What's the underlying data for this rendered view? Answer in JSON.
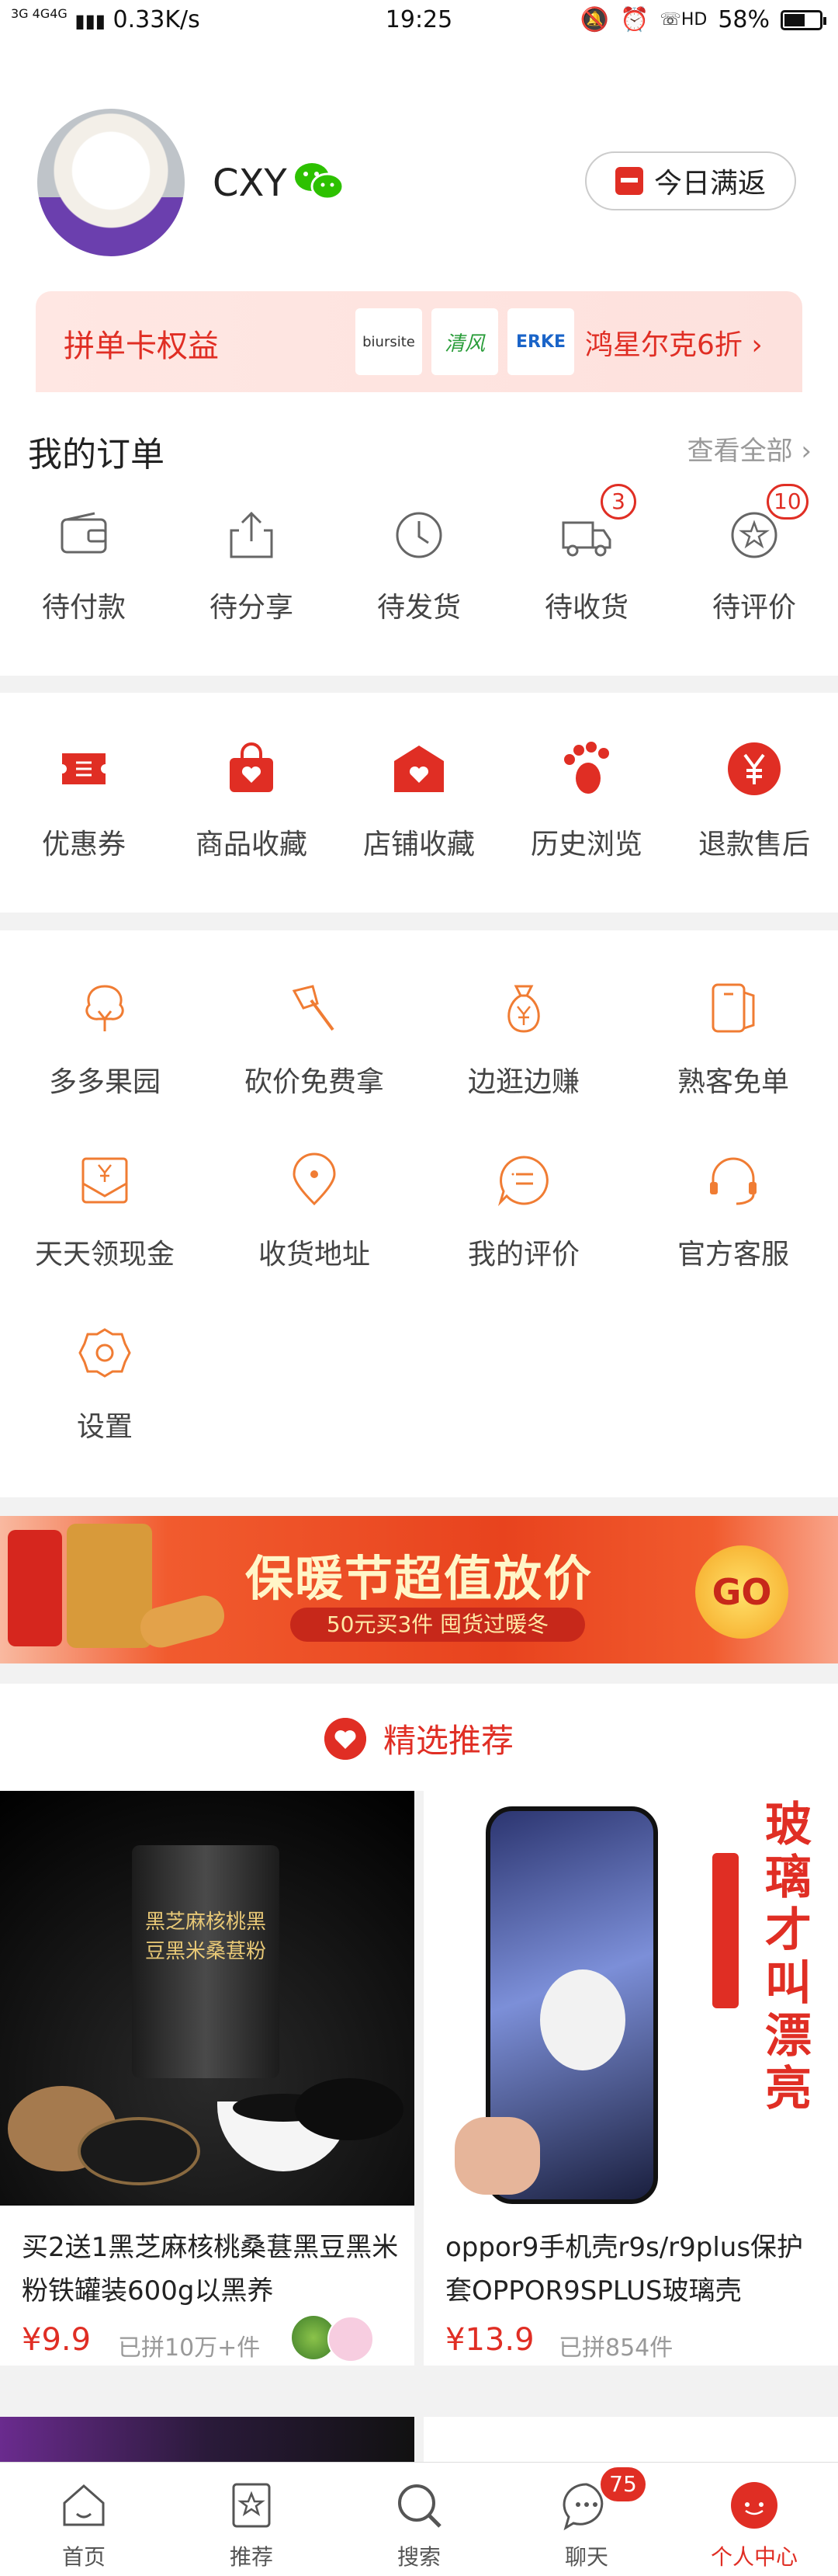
{
  "status_bar": {
    "network": "3G 4G4G",
    "speed": "0.33K/s",
    "time": "19:25",
    "battery": "58%",
    "battery_level": 0.58
  },
  "profile": {
    "username": "CXY",
    "today_button": "今日满返"
  },
  "benefit": {
    "title": "拼单卡权益",
    "brands": [
      "biursite",
      "清风",
      "ERKE"
    ],
    "promo": "鸿星尔克6折"
  },
  "orders": {
    "title": "我的订单",
    "view_all": "查看全部",
    "items": [
      {
        "label": "待付款",
        "icon": "wallet-icon"
      },
      {
        "label": "待分享",
        "icon": "share-icon"
      },
      {
        "label": "待发货",
        "icon": "clock-icon"
      },
      {
        "label": "待收货",
        "icon": "truck-icon",
        "badge": "3"
      },
      {
        "label": "待评价",
        "icon": "review-icon",
        "badge": "10"
      }
    ]
  },
  "quick": {
    "items": [
      {
        "label": "优惠券",
        "icon": "coupon-icon"
      },
      {
        "label": "商品收藏",
        "icon": "bag-heart-icon"
      },
      {
        "label": "店铺收藏",
        "icon": "store-heart-icon"
      },
      {
        "label": "历史浏览",
        "icon": "footprint-icon"
      },
      {
        "label": "退款售后",
        "icon": "yen-icon"
      }
    ]
  },
  "tools": {
    "items": [
      {
        "label": "多多果园",
        "icon": "tree-icon"
      },
      {
        "label": "砍价免费拿",
        "icon": "axe-icon"
      },
      {
        "label": "边逛边赚",
        "icon": "money-bag-icon"
      },
      {
        "label": "熟客免单",
        "icon": "card-icon"
      },
      {
        "label": "天天领现金",
        "icon": "cash-envelope-icon"
      },
      {
        "label": "收货地址",
        "icon": "location-icon"
      },
      {
        "label": "我的评价",
        "icon": "comment-icon"
      },
      {
        "label": "官方客服",
        "icon": "headset-icon"
      },
      {
        "label": "设置",
        "icon": "settings-icon"
      }
    ]
  },
  "banner": {
    "headline": "保暖节超值放价",
    "sub": "50元买3件 囤货过暖冬",
    "go": "GO"
  },
  "recommend": {
    "title": "精选推荐"
  },
  "products": [
    {
      "name": "买2送1黑芝麻核桃桑葚黑豆黑米粉铁罐装600g以黑养",
      "price": "¥9.9",
      "sold": "已拼10万+件",
      "image_text": "黑芝麻核桃黑豆黑米桑葚粉"
    },
    {
      "name": "oppor9手机壳r9s/r9plus保护套OPPOR9SPLUS玻璃壳",
      "price": "¥13.9",
      "sold": "已拼854件",
      "image_text": "玻璃才叫漂亮"
    }
  ],
  "tabbar": {
    "items": [
      {
        "label": "首页",
        "icon": "home-icon"
      },
      {
        "label": "推荐",
        "icon": "recommend-icon"
      },
      {
        "label": "搜索",
        "icon": "search-icon"
      },
      {
        "label": "聊天",
        "icon": "chat-icon",
        "badge": "75"
      },
      {
        "label": "个人中心",
        "icon": "profile-icon",
        "active": true
      }
    ]
  },
  "colors": {
    "accent": "#e02e24",
    "icon_orange": "#f07c33",
    "background": "#f2f2f2"
  }
}
